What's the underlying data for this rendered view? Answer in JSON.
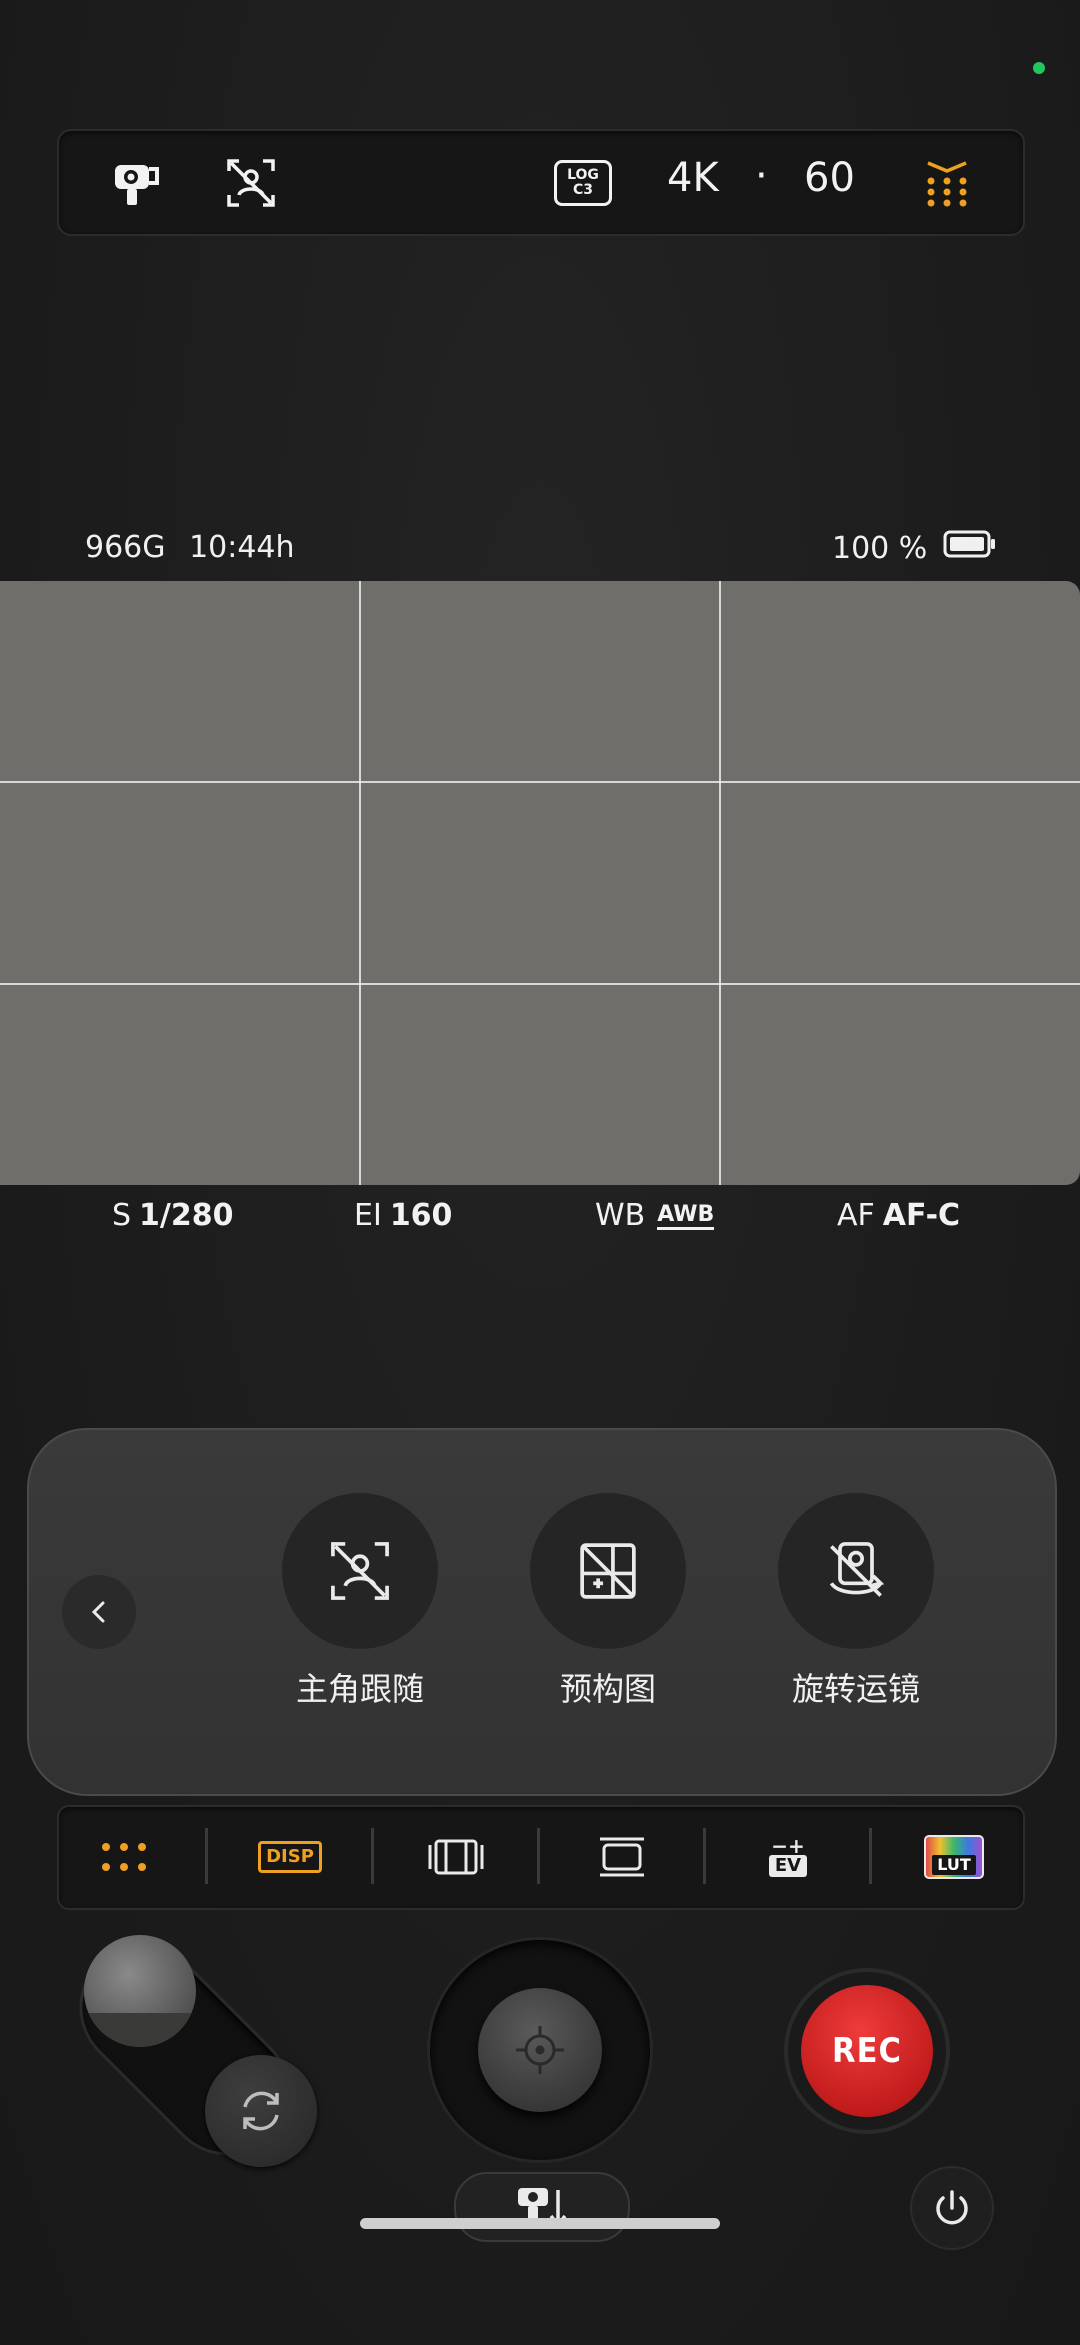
{
  "top_bar": {
    "log_top": "LOG",
    "log_bottom": "C3",
    "resolution": "4K",
    "separator": "·",
    "fps": "60"
  },
  "storage": {
    "remaining": "966G",
    "record_time": "10:44h"
  },
  "battery": {
    "percent": "100 %"
  },
  "params": {
    "shutter_label": "S",
    "shutter_value": "1/280",
    "ei_label": "EI",
    "ei_value": "160",
    "wb_label": "WB",
    "wb_value": "AWB",
    "af_label": "AF",
    "af_value": "AF-C"
  },
  "features": [
    {
      "label": "主角跟随"
    },
    {
      "label": "预构图"
    },
    {
      "label": "旋转运镜"
    }
  ],
  "toolbar": {
    "disp": "DISP",
    "ev": "EV",
    "lut": "LUT"
  },
  "rec": {
    "label": "REC"
  },
  "colors": {
    "accent": "#f0a020",
    "rec": "#d42626",
    "status": "#22c55e"
  }
}
